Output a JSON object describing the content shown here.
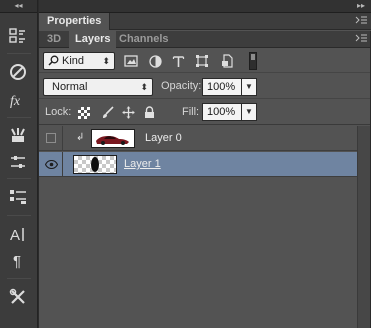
{
  "toolbar": {
    "collapse_glyph": "◂◂",
    "tools": [
      {
        "name": "history-icon"
      },
      {
        "name": "color-icon"
      },
      {
        "name": "brush-presets-icon"
      },
      {
        "name": "clone-source-icon"
      },
      {
        "name": "adjustments-icon"
      },
      {
        "name": "layer-comps-icon"
      },
      {
        "name": "character-icon"
      },
      {
        "name": "paragraph-icon"
      },
      {
        "name": "tools-icon"
      }
    ]
  },
  "panel": {
    "collapse_glyph": "▸▸",
    "properties_tab": "Properties",
    "tabs": [
      {
        "label": "3D",
        "active": false
      },
      {
        "label": "Layers",
        "active": true
      },
      {
        "label": "Channels",
        "active": false
      }
    ],
    "filter": {
      "kind_label": "Kind",
      "icons": [
        "pixel-filter-icon",
        "adjustment-filter-icon",
        "type-filter-icon",
        "shape-filter-icon",
        "smart-object-filter-icon"
      ]
    },
    "blend_mode": "Normal",
    "opacity_label": "Opacity:",
    "opacity_value": "100%",
    "lock_label": "Lock:",
    "fill_label": "Fill:",
    "fill_value": "100%",
    "layers": [
      {
        "name": "Layer 0",
        "visible": false,
        "selected": false,
        "clipped": true
      },
      {
        "name": "Layer 1",
        "visible": true,
        "selected": true,
        "clipped": false
      }
    ]
  },
  "colors": {
    "panel_bg": "#535353",
    "selected_row": "#6f84a1",
    "tab_bar": "#3d3d3d"
  }
}
